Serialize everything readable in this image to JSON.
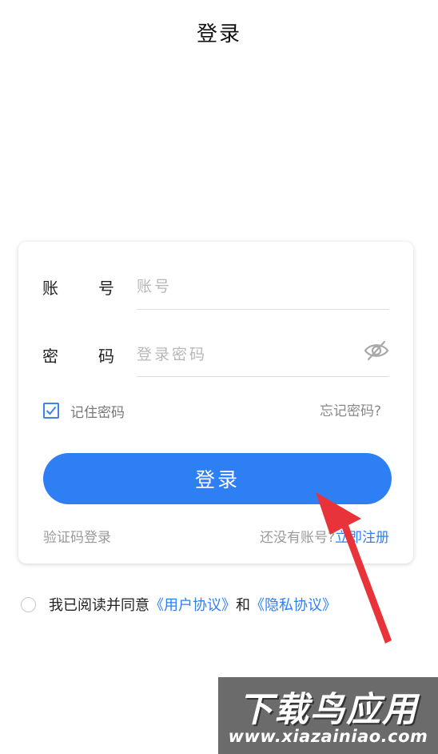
{
  "header": {
    "title": "登录"
  },
  "form": {
    "account": {
      "label_chars": [
        "账",
        "号"
      ],
      "placeholder": "账号",
      "value": ""
    },
    "password": {
      "label_chars": [
        "密",
        "码"
      ],
      "placeholder": "登录密码",
      "value": "",
      "visibility_icon": "eye-slash-icon"
    },
    "remember": {
      "label": "记住密码",
      "checked": true
    },
    "forgot_link": "忘记密码?",
    "login_button": "登录",
    "sms_login_link": "验证码登录",
    "register_prompt": "还没有账号?",
    "register_link": "立即注册"
  },
  "agreement": {
    "checked": false,
    "prefix": "我已阅读并同意",
    "user_agreement": "《用户协议》",
    "conjunction": "和",
    "privacy_policy": "《隐私协议》"
  },
  "annotation": {
    "arrow_icon": "red-arrow-icon",
    "color": "#e8333a"
  },
  "watermark": {
    "title": "下载鸟应用",
    "url": "www.xiazainiao.com"
  },
  "colors": {
    "accent": "#2f7ff4",
    "checkbox": "#3a86e8"
  }
}
